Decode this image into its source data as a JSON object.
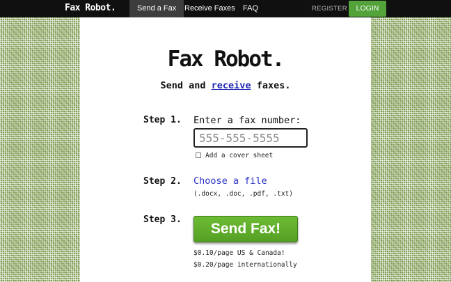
{
  "navbar": {
    "brand": "Fax Robot.",
    "links": [
      "Send a Fax",
      "Receive Faxes",
      "FAQ"
    ],
    "register": "REGISTER",
    "login": "LOGIN"
  },
  "hero": {
    "title": "Fax Robot.",
    "subtitle_pre": "Send and ",
    "subtitle_link": "receive",
    "subtitle_post": " faxes."
  },
  "steps": {
    "step1": {
      "label": "Step 1.",
      "title": "Enter a fax number:",
      "placeholder": "555-555-5555",
      "cover_sheet": "Add a cover sheet"
    },
    "step2": {
      "label": "Step 2.",
      "title": "Choose a file",
      "file_types": "(.docx, .doc, .pdf, .txt)"
    },
    "step3": {
      "label": "Step 3.",
      "button": "Send Fax!",
      "price_us": "$0.10/page US & Canada!",
      "price_intl": "$0.20/page internationally"
    }
  },
  "colors": {
    "navbar_bg": "#101010",
    "login_bg": "#53a23a",
    "send_button": "#62ad2b",
    "link": "#2a30c8",
    "background_pattern": "#7f9b52"
  }
}
